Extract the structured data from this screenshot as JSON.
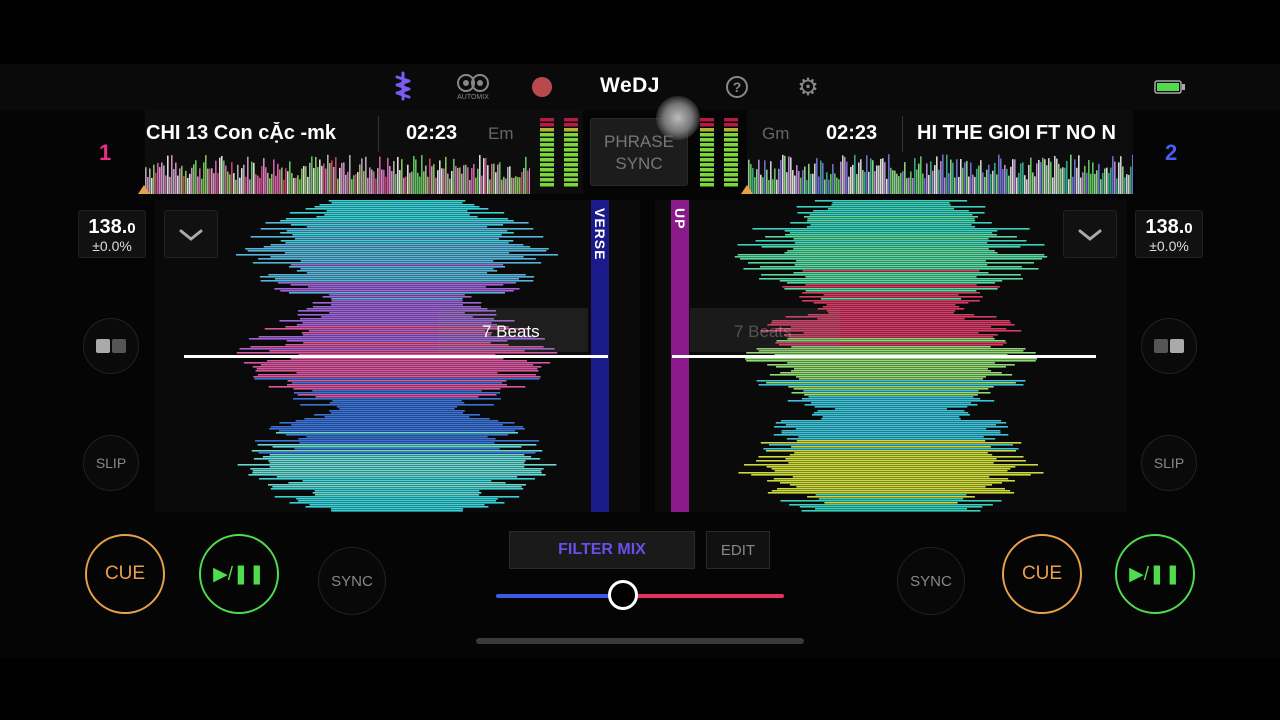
{
  "app": {
    "logo": "WeDJ",
    "automix_label": "AUTOMIX"
  },
  "colors": {
    "deck1": "#e8308a",
    "deck2": "#4b5cf0",
    "cue": "#e8a04a",
    "play": "#4fdc4f",
    "accent": "#6a4ee8",
    "crossfader_left": "#3b5ce8",
    "crossfader_right": "#e8305c"
  },
  "icons": [
    "waveform-icon",
    "automix-icon",
    "record-icon",
    "help-icon",
    "gear-icon",
    "battery-icon"
  ],
  "deck1": {
    "number": "1",
    "title": "CHI 13 Con cẶc -mk",
    "time": "02:23",
    "key": "Em",
    "bpm_main": "138.",
    "bpm_dec": "0",
    "pitch": "±0.0%",
    "phrase": "VERSE",
    "beats_label": "7 Beats",
    "cue": "CUE",
    "play": "▶/❚❚",
    "sync": "SYNC",
    "slip": "SLIP"
  },
  "deck2": {
    "number": "2",
    "title": "HI THE GIOI FT NO N",
    "time": "02:23",
    "key": "Gm",
    "bpm_main": "138.",
    "bpm_dec": "0",
    "pitch": "±0.0%",
    "phrase": "UP",
    "beats_label": "7 Beats",
    "cue": "CUE",
    "play": "▶/❚❚",
    "sync": "SYNC",
    "slip": "SLIP"
  },
  "phrase_sync": {
    "line1": "PHRASE",
    "line2": "SYNC"
  },
  "mixer": {
    "filter_mix": "FILTER MIX",
    "edit": "EDIT",
    "crossfader_position": 0.44
  }
}
